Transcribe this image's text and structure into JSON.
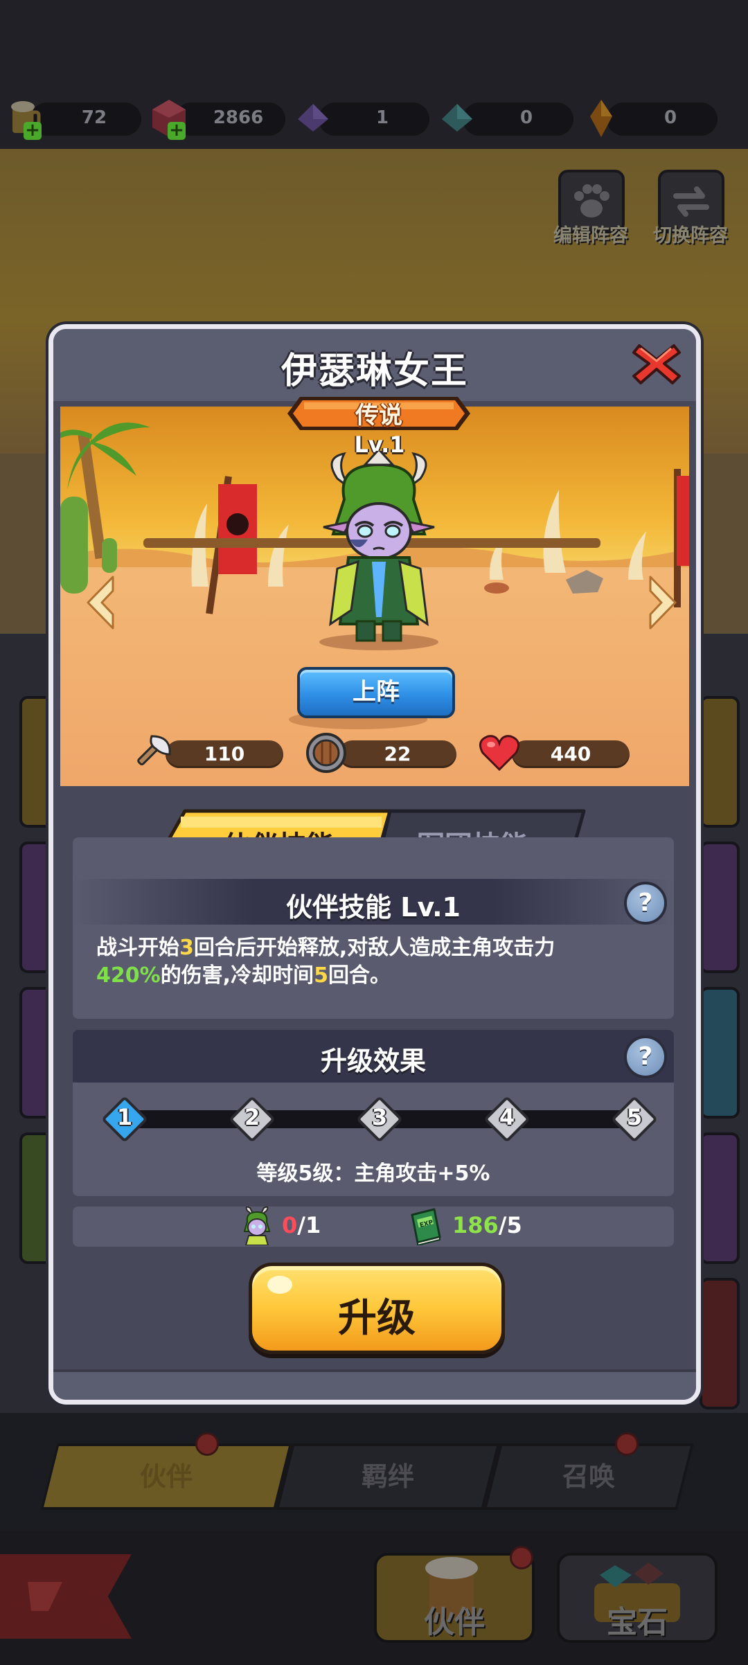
{
  "resources": [
    {
      "value": "72",
      "icon": "beer-mug-icon",
      "has_plus": true
    },
    {
      "value": "2866",
      "icon": "red-gem-icon",
      "has_plus": true
    },
    {
      "value": "1",
      "icon": "purple-crystal-icon",
      "has_plus": false
    },
    {
      "value": "0",
      "icon": "teal-crystal-icon",
      "has_plus": false
    },
    {
      "value": "0",
      "icon": "orange-crystal-icon",
      "has_plus": false
    }
  ],
  "top_buttons": {
    "edit_lineup": "编辑阵容",
    "switch_lineup": "切换阵容"
  },
  "modal": {
    "title": "伊瑟琳女王",
    "rarity": "传说",
    "level": "Lv.1",
    "deploy_label": "上阵",
    "stats": {
      "attack": "110",
      "defense": "22",
      "hp": "440"
    },
    "tabs": {
      "partner_skill": "伙伴技能",
      "legion_skill": "军团技能",
      "active": "partner_skill"
    },
    "skill": {
      "title": "伙伴技能 Lv.1",
      "desc_part1": "战斗开始",
      "rounds_before": "3",
      "desc_part2": "回合后开始释放,对敌人造成主角攻击力",
      "percent": "420%",
      "desc_part3": "的伤害,冷却时间",
      "cooldown": "5",
      "desc_part4": "回合。",
      "help": "?"
    },
    "upgrade_effect": {
      "title": "升级效果",
      "levels": [
        "1",
        "2",
        "3",
        "4",
        "5"
      ],
      "current_level": 1,
      "effect_text": "等级5级：主角攻击+5%",
      "help": "?"
    },
    "requirements": {
      "fragments_have": "0",
      "fragments_need": "/1",
      "exp_have": "186",
      "exp_need": "/5",
      "exp_badge": "EXP"
    },
    "upgrade_label": "升级"
  },
  "bottom_tabs": {
    "partner": "伙伴",
    "bond": "羁绊",
    "summon": "召唤"
  },
  "bottom_nav": {
    "partner": "伙伴",
    "gem": "宝石"
  },
  "colors": {
    "modal_bg": "#474859",
    "rarity_orange": "#f07a22",
    "deploy_blue": "#2f8fe6",
    "upgrade_yellow": "#ffc73a",
    "active_node": "#36a7ee"
  }
}
